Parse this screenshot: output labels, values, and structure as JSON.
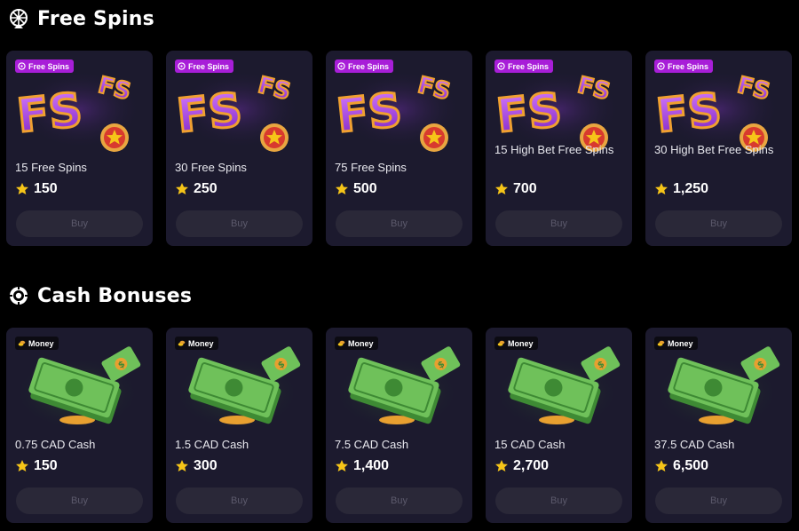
{
  "colors": {
    "background": "#000000",
    "card": "#1c1a2e",
    "badge_free_spins": "#a81ed8",
    "badge_money": "#0c0b12",
    "star": "#f6c518",
    "buy_button": "#2a2838",
    "buy_text": "#5c5a6c"
  },
  "free_spins": {
    "title": "Free Spins",
    "icon": "wheel-icon",
    "badge_label": "Free Spins",
    "items": [
      {
        "name": "15 Free Spins",
        "price": "150",
        "buy_label": "Buy"
      },
      {
        "name": "30 Free Spins",
        "price": "250",
        "buy_label": "Buy"
      },
      {
        "name": "75 Free Spins",
        "price": "500",
        "buy_label": "Buy"
      },
      {
        "name": "15 High Bet Free Spins",
        "price": "700",
        "buy_label": "Buy"
      },
      {
        "name": "30 High Bet Free Spins",
        "price": "1,250",
        "buy_label": "Buy"
      }
    ]
  },
  "cash_bonuses": {
    "title": "Cash Bonuses",
    "icon": "chip-icon",
    "badge_label": "Money",
    "items": [
      {
        "name": "0.75 CAD Cash",
        "price": "150",
        "buy_label": "Buy"
      },
      {
        "name": "1.5 CAD Cash",
        "price": "300",
        "buy_label": "Buy"
      },
      {
        "name": "7.5 CAD Cash",
        "price": "1,400",
        "buy_label": "Buy"
      },
      {
        "name": "15 CAD Cash",
        "price": "2,700",
        "buy_label": "Buy"
      },
      {
        "name": "37.5 CAD Cash",
        "price": "6,500",
        "buy_label": "Buy"
      }
    ]
  }
}
